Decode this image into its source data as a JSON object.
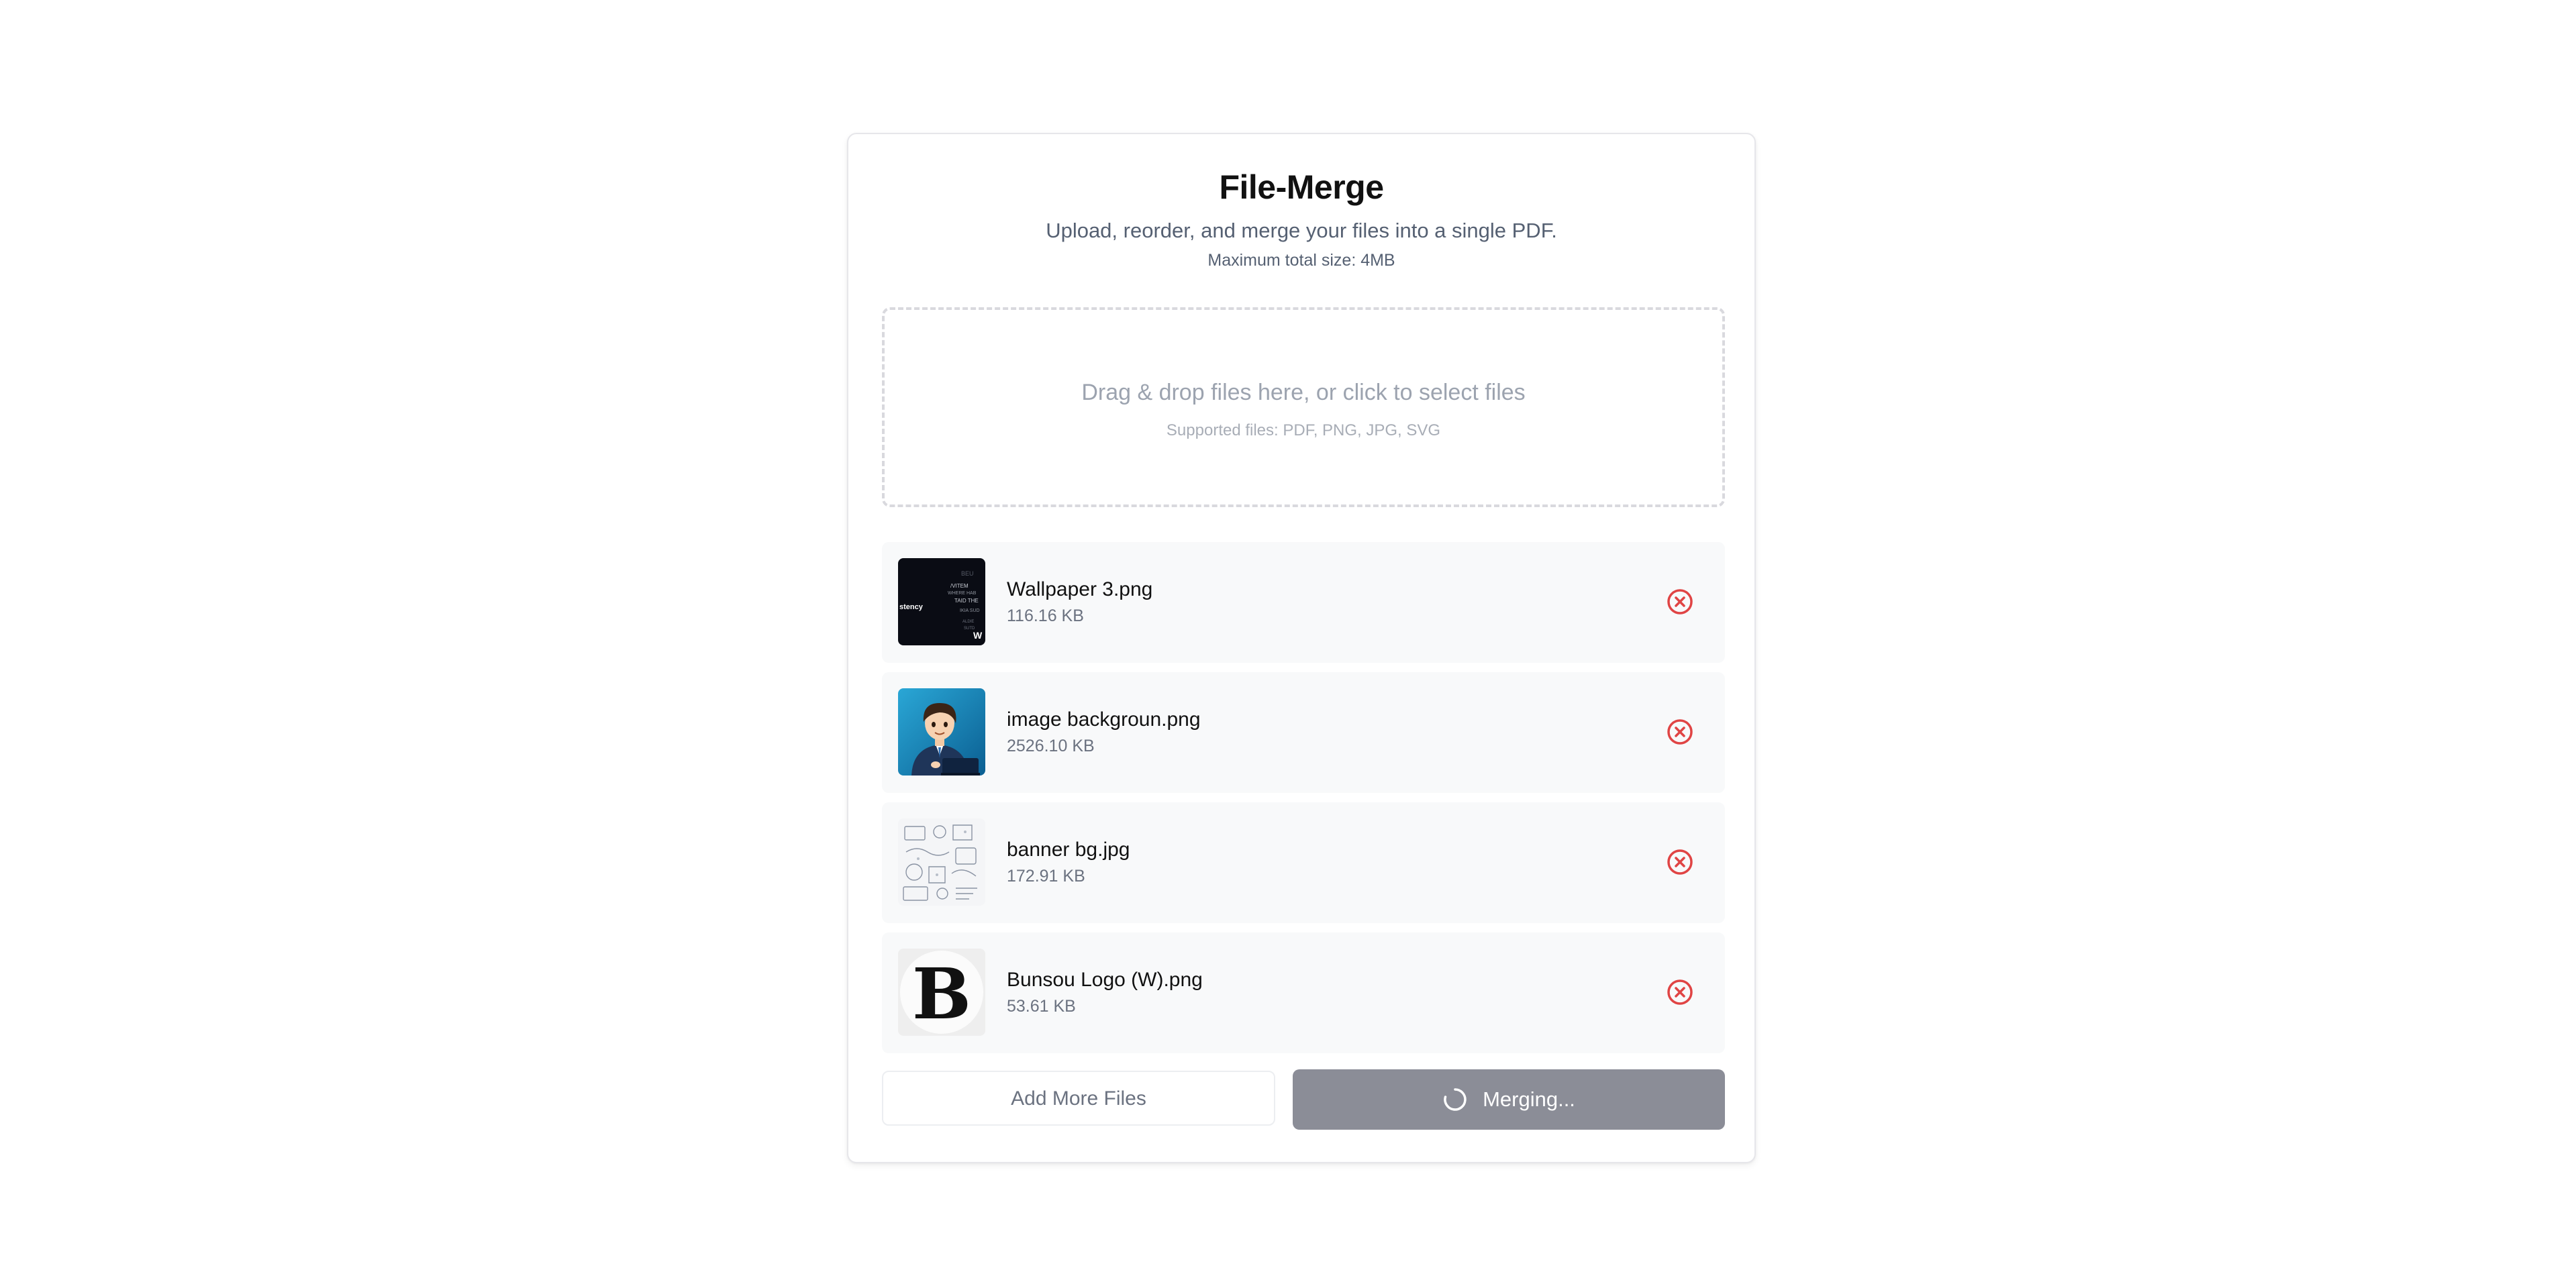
{
  "app": {
    "title": "File-Merge",
    "subtitle": "Upload, reorder, and merge your files into a single PDF.",
    "max_size": "Maximum total size: 4MB"
  },
  "dropzone": {
    "main_text": "Drag & drop files here, or click to select files",
    "supported_text": "Supported files: PDF, PNG, JPG, SVG"
  },
  "files": [
    {
      "name": "Wallpaper 3.png",
      "size": "116.16 KB",
      "thumbnail": "dark-wallpaper-thumbnail"
    },
    {
      "name": "image backgroun.png",
      "size": "2526.10 KB",
      "thumbnail": "cartoon-man-laptop-thumbnail"
    },
    {
      "name": "banner bg.jpg",
      "size": "172.91 KB",
      "thumbnail": "doodle-sketch-thumbnail"
    },
    {
      "name": "Bunsou Logo (W).png",
      "size": "53.61 KB",
      "thumbnail": "b-logo-thumbnail"
    }
  ],
  "actions": {
    "add_more_label": "Add More Files",
    "merge_label": "Merging..."
  },
  "colors": {
    "remove_icon": "#e04444",
    "merge_button": "#8b8d97",
    "row_background": "#f8f9fa",
    "dropzone_border": "#d9d9de"
  },
  "icons": {
    "remove": "x-circle-icon",
    "loading": "spinner-icon"
  }
}
